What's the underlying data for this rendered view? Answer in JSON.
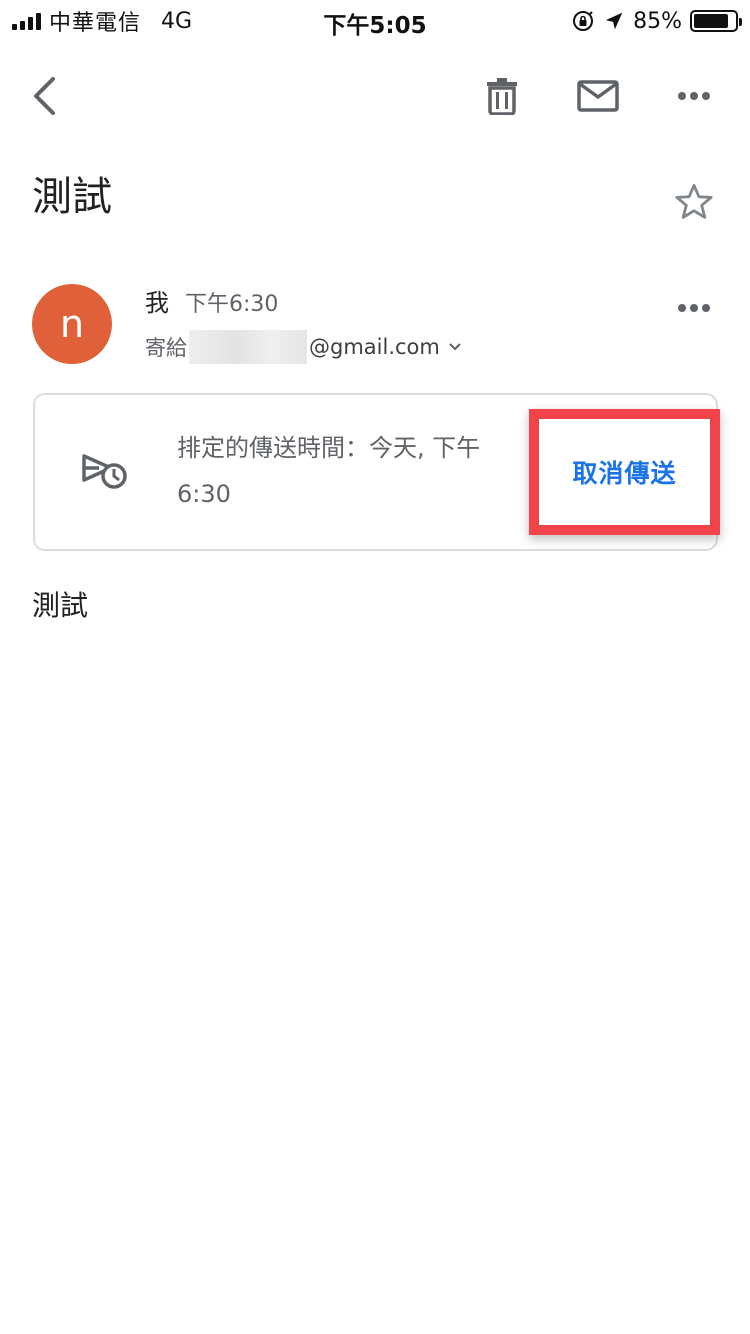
{
  "status_bar": {
    "carrier": "中華電信",
    "network": "4G",
    "time": "下午5:05",
    "battery_percent": "85%",
    "battery_level": 0.85,
    "icons": [
      "signal-icon",
      "rotation-lock-icon",
      "location-arrow-icon",
      "battery-icon"
    ]
  },
  "toolbar": {
    "icons": [
      "back-arrow-icon",
      "trash-icon",
      "mail-icon",
      "more-horizontal-icon"
    ]
  },
  "email": {
    "subject": "測試",
    "starred": false,
    "sender": {
      "avatar_letter": "n",
      "avatar_color": "#e0603a",
      "name": "我",
      "time": "下午6:30",
      "recipient_prefix": "寄給",
      "recipient_domain": "@gmail.com"
    },
    "schedule": {
      "text": "排定的傳送時間：今天, 下午6:30",
      "cancel_label": "取消傳送",
      "cancel_color": "#1a73e8",
      "highlight_color": "#f2434a"
    },
    "body": "測試"
  }
}
